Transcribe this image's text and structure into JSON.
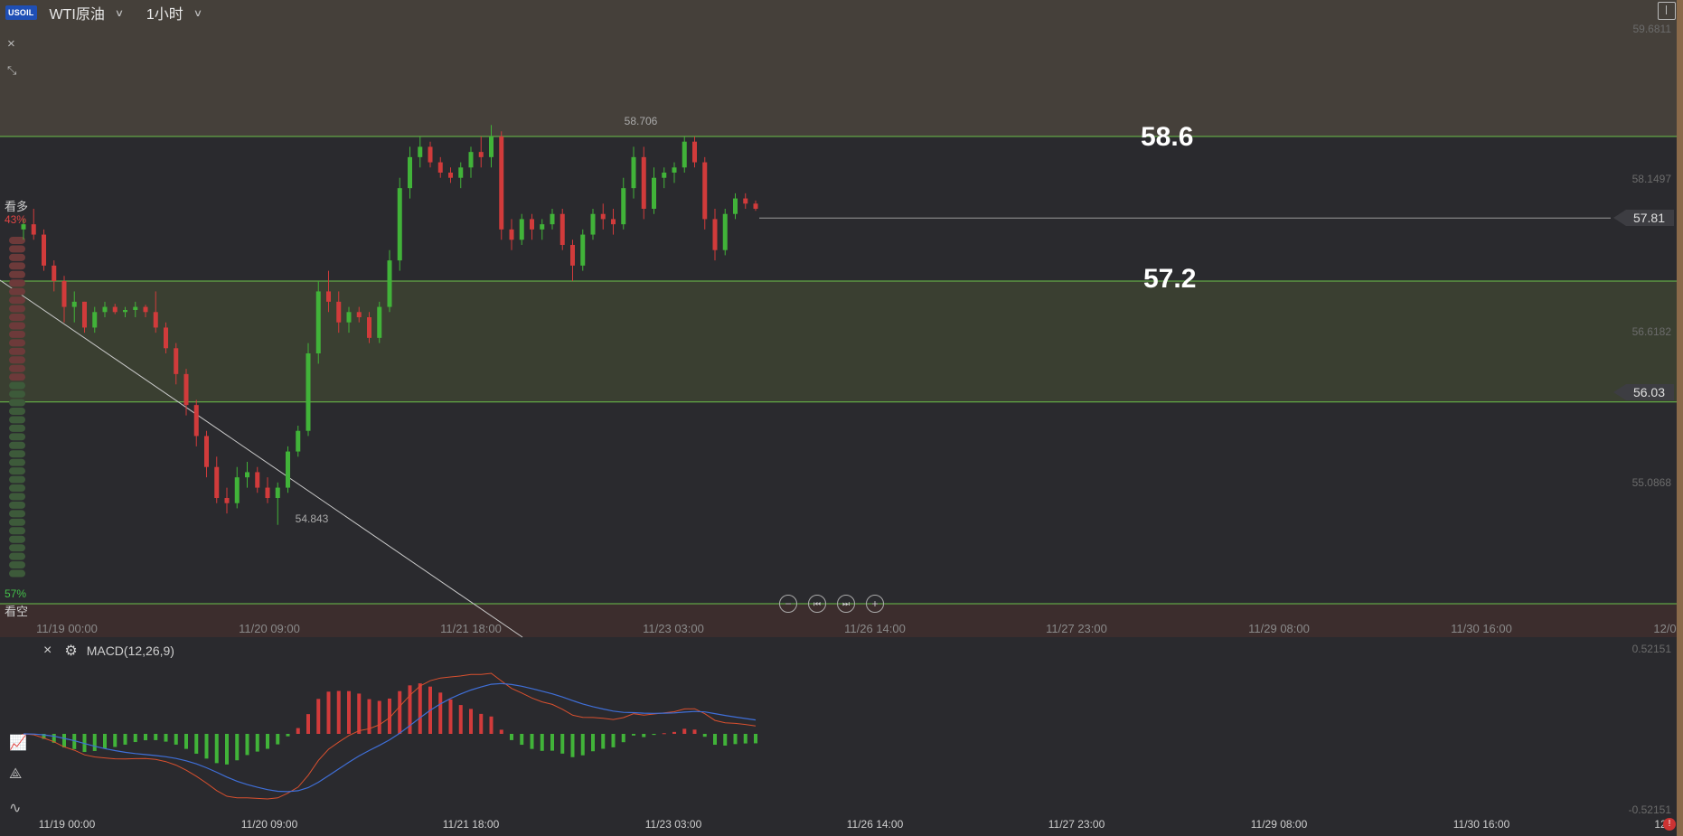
{
  "header": {
    "symbol_badge": "USOIL",
    "symbol_name": "WTI原油",
    "timeframe": "1小时",
    "close_icon": "×",
    "collapse_icon": "collapse-icon",
    "layout_icon": "layout-icon"
  },
  "sentiment": {
    "bull_label": "看多",
    "bull_pct": "43%",
    "bear_label": "看空",
    "bear_pct": "57%",
    "bull_fraction": 0.43
  },
  "price_axis": {
    "labels": [
      "59.6811",
      "58.1497",
      "56.6182",
      "55.0868"
    ],
    "current_price": "57.81",
    "marker_price": "56.03"
  },
  "annotations": {
    "high_label": "58.706",
    "low_label": "54.843",
    "resistance_label": "58.6",
    "support_label": "57.2"
  },
  "time_axis": {
    "labels": [
      "11/19 00:00",
      "11/20 09:00",
      "11/21 18:00",
      "11/23 03:00",
      "11/26 14:00",
      "11/27 23:00",
      "11/29 08:00",
      "11/30 16:00",
      "12/0"
    ]
  },
  "macd": {
    "title": "MACD(12,26,9)",
    "axis_top": "0.52151",
    "axis_bottom": "-0.52151"
  },
  "navigation": {
    "zoom_out": "−",
    "back": "⏮",
    "forward": "⏭",
    "zoom_in": "+"
  },
  "colors": {
    "up": "#41b339",
    "down": "#d13b3b",
    "macd_line": "#3f6fd8",
    "signal_line": "#d9502e",
    "level_line": "#6cc24a"
  },
  "chart_data": {
    "type": "candlestick",
    "ylim": [
      54.0,
      59.9
    ],
    "levels": [
      58.6,
      57.2,
      56.03
    ],
    "high": 58.706,
    "low": 54.843,
    "last": 57.81,
    "candles": [
      [
        57.7,
        57.8,
        57.6,
        57.75
      ],
      [
        57.75,
        57.9,
        57.6,
        57.65
      ],
      [
        57.65,
        57.7,
        57.3,
        57.35
      ],
      [
        57.35,
        57.4,
        57.1,
        57.2
      ],
      [
        57.2,
        57.25,
        56.8,
        56.95
      ],
      [
        56.95,
        57.1,
        56.8,
        57.0
      ],
      [
        57.0,
        57.0,
        56.7,
        56.75
      ],
      [
        56.75,
        56.95,
        56.7,
        56.9
      ],
      [
        56.9,
        57.0,
        56.85,
        56.95
      ],
      [
        56.95,
        56.98,
        56.88,
        56.9
      ],
      [
        56.9,
        56.95,
        56.85,
        56.92
      ],
      [
        56.92,
        57.0,
        56.85,
        56.95
      ],
      [
        56.95,
        56.97,
        56.85,
        56.9
      ],
      [
        56.9,
        57.1,
        56.7,
        56.75
      ],
      [
        56.75,
        56.8,
        56.5,
        56.55
      ],
      [
        56.55,
        56.6,
        56.2,
        56.3
      ],
      [
        56.3,
        56.35,
        55.9,
        56.0
      ],
      [
        56.0,
        56.05,
        55.6,
        55.7
      ],
      [
        55.7,
        55.75,
        55.3,
        55.4
      ],
      [
        55.4,
        55.5,
        55.05,
        55.1
      ],
      [
        55.1,
        55.2,
        54.95,
        55.05
      ],
      [
        55.05,
        55.4,
        55.0,
        55.3
      ],
      [
        55.3,
        55.45,
        55.2,
        55.35
      ],
      [
        55.35,
        55.4,
        55.15,
        55.2
      ],
      [
        55.2,
        55.3,
        55.05,
        55.1
      ],
      [
        55.1,
        55.25,
        54.84,
        55.2
      ],
      [
        55.2,
        55.6,
        55.15,
        55.55
      ],
      [
        55.55,
        55.8,
        55.5,
        55.75
      ],
      [
        55.75,
        56.6,
        55.7,
        56.5
      ],
      [
        56.5,
        57.2,
        56.4,
        57.1
      ],
      [
        57.1,
        57.3,
        56.9,
        57.0
      ],
      [
        57.0,
        57.1,
        56.7,
        56.8
      ],
      [
        56.8,
        56.95,
        56.7,
        56.9
      ],
      [
        56.9,
        56.95,
        56.8,
        56.85
      ],
      [
        56.85,
        56.9,
        56.6,
        56.65
      ],
      [
        56.65,
        57.0,
        56.6,
        56.95
      ],
      [
        56.95,
        57.5,
        56.9,
        57.4
      ],
      [
        57.4,
        58.2,
        57.3,
        58.1
      ],
      [
        58.1,
        58.5,
        58.0,
        58.4
      ],
      [
        58.4,
        58.6,
        58.3,
        58.5
      ],
      [
        58.5,
        58.55,
        58.3,
        58.35
      ],
      [
        58.35,
        58.4,
        58.2,
        58.25
      ],
      [
        58.25,
        58.3,
        58.15,
        58.2
      ],
      [
        58.2,
        58.35,
        58.1,
        58.3
      ],
      [
        58.3,
        58.5,
        58.2,
        58.45
      ],
      [
        58.45,
        58.6,
        58.3,
        58.4
      ],
      [
        58.4,
        58.71,
        58.3,
        58.6
      ],
      [
        58.6,
        58.65,
        57.6,
        57.7
      ],
      [
        57.7,
        57.8,
        57.5,
        57.6
      ],
      [
        57.6,
        57.85,
        57.55,
        57.8
      ],
      [
        57.8,
        57.85,
        57.6,
        57.7
      ],
      [
        57.7,
        57.8,
        57.6,
        57.75
      ],
      [
        57.75,
        57.9,
        57.7,
        57.85
      ],
      [
        57.85,
        57.9,
        57.5,
        57.55
      ],
      [
        57.55,
        57.6,
        57.2,
        57.35
      ],
      [
        57.35,
        57.7,
        57.3,
        57.65
      ],
      [
        57.65,
        57.9,
        57.6,
        57.85
      ],
      [
        57.85,
        57.95,
        57.7,
        57.8
      ],
      [
        57.8,
        57.9,
        57.65,
        57.75
      ],
      [
        57.75,
        58.2,
        57.7,
        58.1
      ],
      [
        58.1,
        58.5,
        58.0,
        58.4
      ],
      [
        58.4,
        58.5,
        57.8,
        57.9
      ],
      [
        57.9,
        58.3,
        57.85,
        58.2
      ],
      [
        58.2,
        58.3,
        58.1,
        58.25
      ],
      [
        58.25,
        58.35,
        58.15,
        58.3
      ],
      [
        58.3,
        58.6,
        58.25,
        58.55
      ],
      [
        58.55,
        58.6,
        58.3,
        58.35
      ],
      [
        58.35,
        58.4,
        57.7,
        57.8
      ],
      [
        57.8,
        57.9,
        57.4,
        57.5
      ],
      [
        57.5,
        57.9,
        57.45,
        57.85
      ],
      [
        57.85,
        58.05,
        57.8,
        58.0
      ],
      [
        58.0,
        58.05,
        57.9,
        57.95
      ],
      [
        57.95,
        57.98,
        57.88,
        57.9
      ]
    ]
  }
}
